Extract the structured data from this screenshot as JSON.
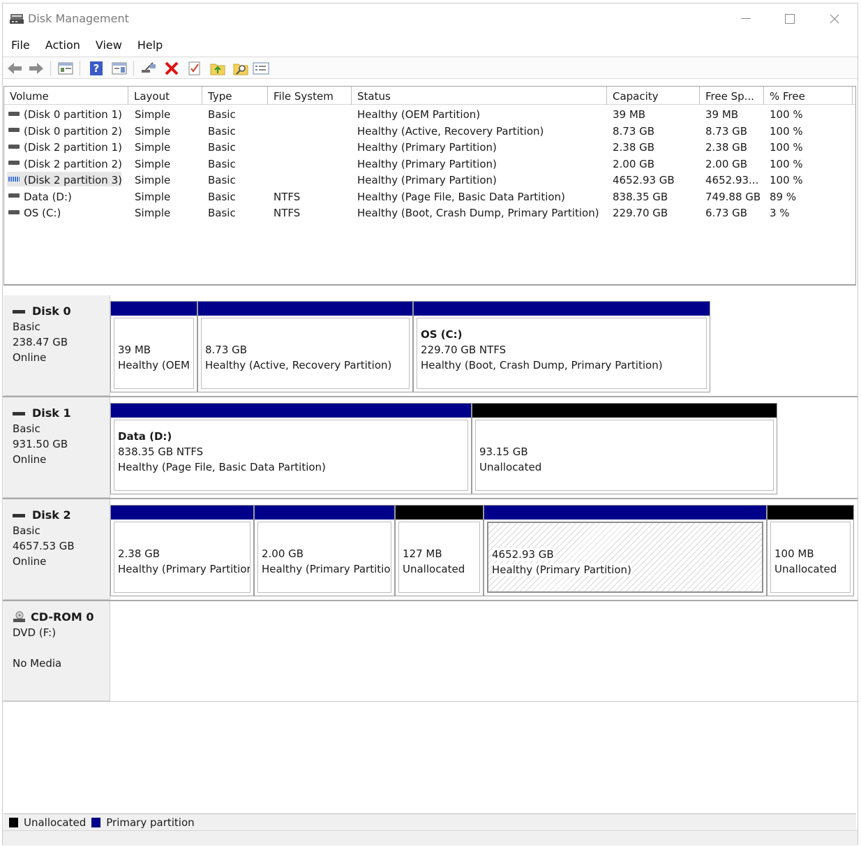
{
  "window": {
    "title": "Disk Management",
    "icon": "disk-management-icon"
  },
  "menu": [
    "File",
    "Action",
    "View",
    "Help"
  ],
  "toolbar": {
    "buttons": [
      "back-icon",
      "forward-icon",
      "up-list-icon",
      "help-icon",
      "show-hide-icon",
      "connect-icon",
      "delete-icon",
      "check-icon",
      "folder-up-icon",
      "folder-search-icon",
      "properties-icon"
    ]
  },
  "volume_list": {
    "columns": [
      "Volume",
      "Layout",
      "Type",
      "File System",
      "Status",
      "Capacity",
      "Free Sp...",
      "% Free"
    ],
    "rows": [
      {
        "volume": "(Disk 0 partition 1)",
        "layout": "Simple",
        "type": "Basic",
        "fs": "",
        "status": "Healthy (OEM Partition)",
        "capacity": "39 MB",
        "free": "39 MB",
        "pct": "100 %"
      },
      {
        "volume": "(Disk 0 partition 2)",
        "layout": "Simple",
        "type": "Basic",
        "fs": "",
        "status": "Healthy (Active, Recovery Partition)",
        "capacity": "8.73 GB",
        "free": "8.73 GB",
        "pct": "100 %"
      },
      {
        "volume": "(Disk 2 partition 1)",
        "layout": "Simple",
        "type": "Basic",
        "fs": "",
        "status": "Healthy (Primary Partition)",
        "capacity": "2.38 GB",
        "free": "2.38 GB",
        "pct": "100 %"
      },
      {
        "volume": "(Disk 2 partition 2)",
        "layout": "Simple",
        "type": "Basic",
        "fs": "",
        "status": "Healthy (Primary Partition)",
        "capacity": "2.00 GB",
        "free": "2.00 GB",
        "pct": "100 %"
      },
      {
        "volume": "(Disk 2 partition 3)",
        "layout": "Simple",
        "type": "Basic",
        "fs": "",
        "status": "Healthy (Primary Partition)",
        "capacity": "4652.93 GB",
        "free": "4652.93...",
        "pct": "100 %"
      },
      {
        "volume": "Data (D:)",
        "layout": "Simple",
        "type": "Basic",
        "fs": "NTFS",
        "status": "Healthy (Page File, Basic Data Partition)",
        "capacity": "838.35 GB",
        "free": "749.88 GB",
        "pct": "89 %"
      },
      {
        "volume": "OS (C:)",
        "layout": "Simple",
        "type": "Basic",
        "fs": "NTFS",
        "status": "Healthy (Boot, Crash Dump, Primary Partition)",
        "capacity": "229.70 GB",
        "free": "6.73 GB",
        "pct": "3 %"
      }
    ]
  },
  "disks": [
    {
      "name": "Disk 0",
      "type": "Basic",
      "size": "238.47 GB",
      "state": "Online",
      "partitions": [
        {
          "title": "",
          "size": "39 MB",
          "status": "Healthy (OEM"
        },
        {
          "title": "",
          "size": "8.73 GB",
          "status": "Healthy (Active, Recovery Partition)"
        },
        {
          "title": "OS  (C:)",
          "size": "229.70 GB NTFS",
          "status": "Healthy (Boot, Crash Dump, Primary Partition)"
        }
      ]
    },
    {
      "name": "Disk 1",
      "type": "Basic",
      "size": "931.50 GB",
      "state": "Online",
      "partitions": [
        {
          "title": "Data  (D:)",
          "size": "838.35 GB NTFS",
          "status": "Healthy (Page File, Basic Data Partition)"
        },
        {
          "title": "",
          "size": "93.15 GB",
          "status": "Unallocated"
        }
      ]
    },
    {
      "name": "Disk 2",
      "type": "Basic",
      "size": "4657.53 GB",
      "state": "Online",
      "partitions": [
        {
          "title": "",
          "size": "2.38 GB",
          "status": "Healthy (Primary Partitior"
        },
        {
          "title": "",
          "size": "2.00 GB",
          "status": "Healthy (Primary Partitio"
        },
        {
          "title": "",
          "size": "127 MB",
          "status": "Unallocated"
        },
        {
          "title": "",
          "size": "4652.93 GB",
          "status": "Healthy (Primary Partition)"
        },
        {
          "title": "",
          "size": "100 MB",
          "status": "Unallocated"
        }
      ]
    },
    {
      "name": "CD-ROM 0",
      "type": "DVD (F:)",
      "size": "",
      "state": "No Media",
      "partitions": []
    }
  ],
  "legend": {
    "unallocated": "Unallocated",
    "primary": "Primary partition"
  },
  "colors": {
    "primary": "#00008b",
    "unallocated": "#000000"
  }
}
